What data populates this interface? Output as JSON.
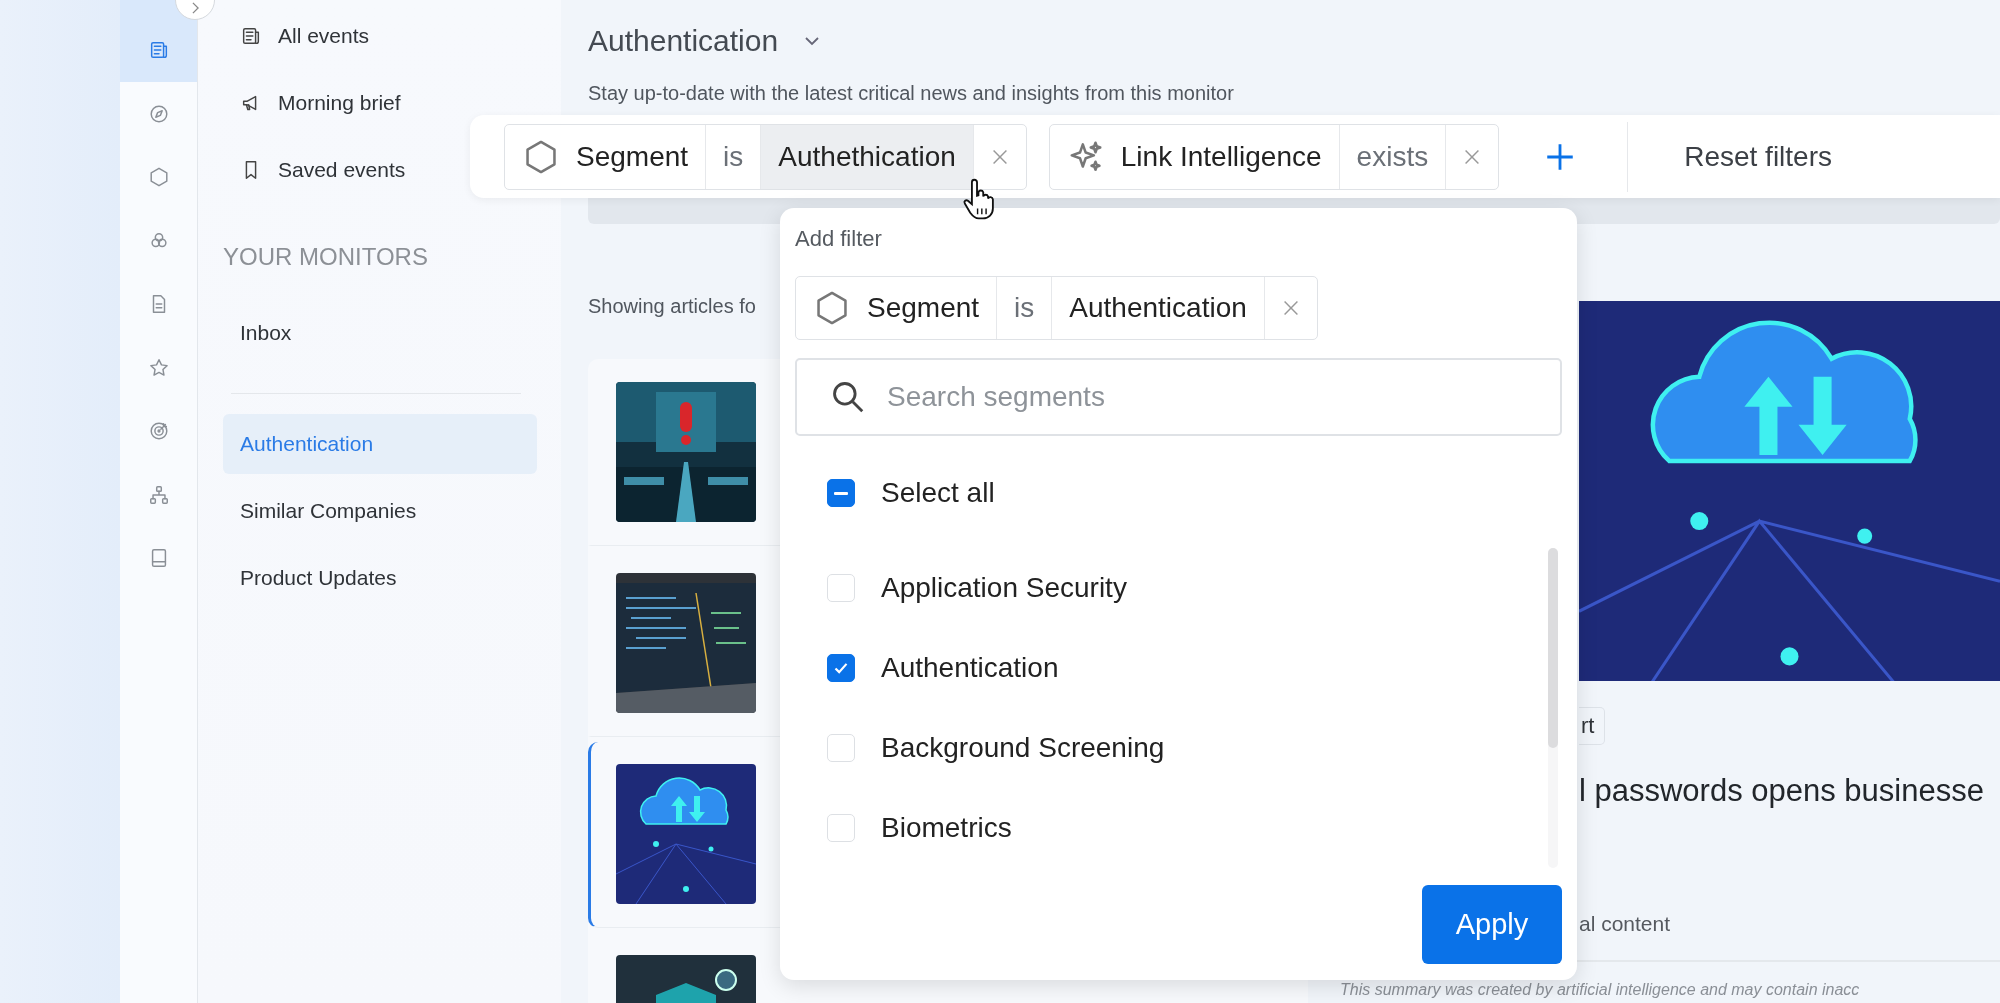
{
  "rail": [
    {
      "selected": true
    },
    {
      "selected": false
    },
    {
      "selected": false
    },
    {
      "selected": false
    },
    {
      "selected": false
    },
    {
      "selected": false
    },
    {
      "selected": false
    },
    {
      "selected": false
    },
    {
      "selected": false
    }
  ],
  "nav": {
    "items": [
      {
        "label": "All events"
      },
      {
        "label": "Morning brief"
      },
      {
        "label": "Saved events"
      }
    ],
    "section_title": "YOUR MONITORS",
    "inbox": "Inbox",
    "monitors": [
      {
        "label": "Authentication",
        "selected": true
      },
      {
        "label": "Similar Companies",
        "selected": false
      },
      {
        "label": "Product Updates",
        "selected": false
      }
    ]
  },
  "header": {
    "title": "Authentication",
    "subtitle": "Stay up-to-date with the latest critical news and insights from this monitor"
  },
  "filters": [
    {
      "field": "Segment",
      "operator": "is",
      "value": "Authethication",
      "value_highlighted": true
    },
    {
      "field": "Link Intelligence",
      "operator": "exists"
    }
  ],
  "reset_label": "Reset filters",
  "showing_text": "Showing articles fo",
  "articles": [
    {
      "selected": false
    },
    {
      "selected": false
    },
    {
      "selected": true
    },
    {
      "selected": false
    }
  ],
  "detail": {
    "tag": "rt",
    "headline": "l passwords opens businesse",
    "link": "al content",
    "note": "This summary was created by artificial intelligence and may contain inacc"
  },
  "dropdown": {
    "title": "Add filter",
    "chip": {
      "field": "Segment",
      "operator": "is",
      "value": "Authentication"
    },
    "search_placeholder": "Search segments",
    "select_all": {
      "label": "Select all",
      "indeterminate": true
    },
    "options": [
      {
        "label": "Application Security",
        "checked": false
      },
      {
        "label": "Authentication",
        "checked": true
      },
      {
        "label": "Background Screening",
        "checked": false
      },
      {
        "label": "Biometrics",
        "checked": false
      }
    ],
    "apply_label": "Apply"
  }
}
